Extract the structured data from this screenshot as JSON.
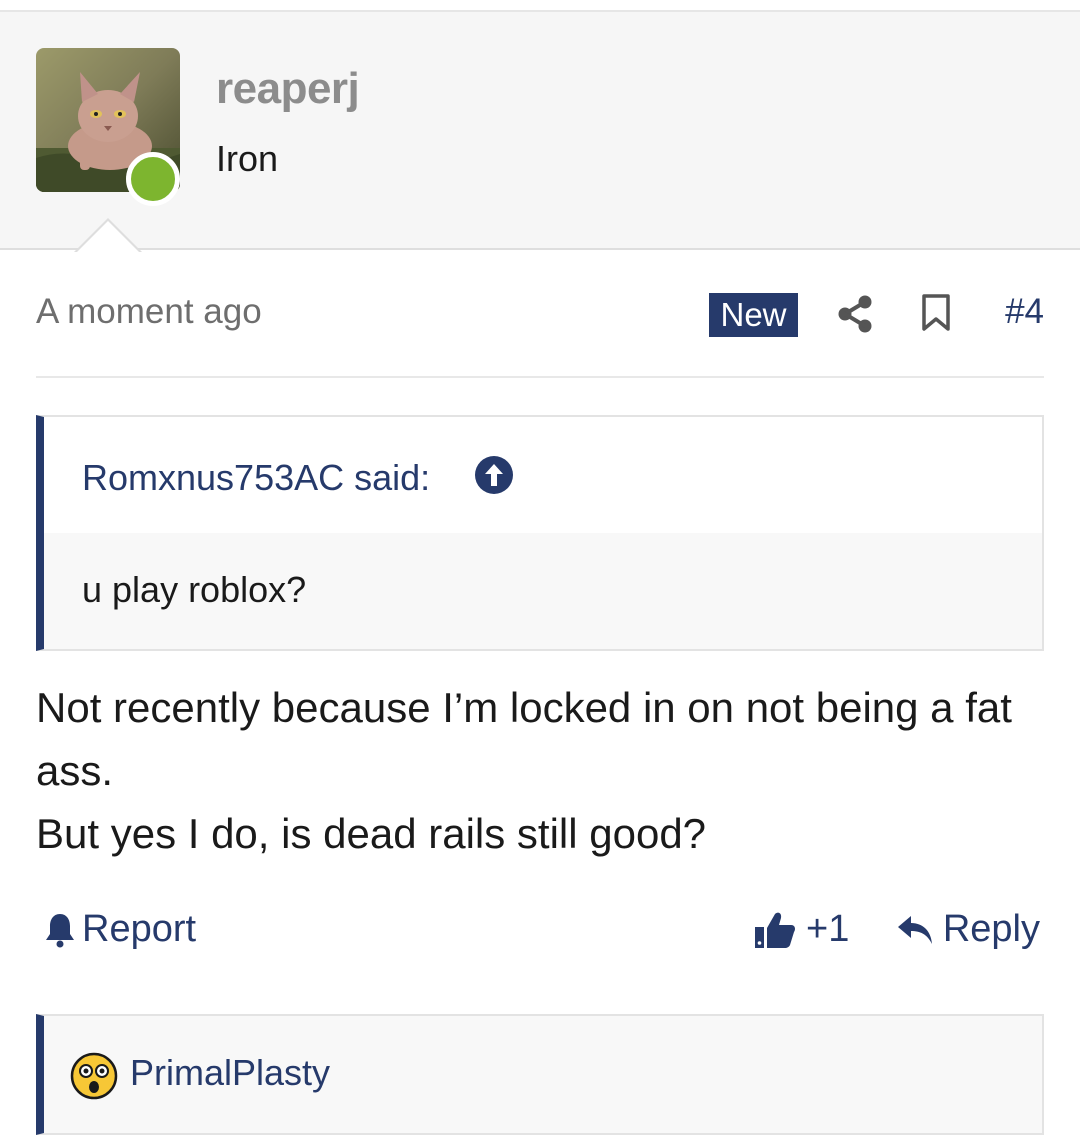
{
  "author": {
    "username": "reaperj",
    "title": "Iron",
    "avatar": "hairless-sphynx-cat-photo",
    "online": true
  },
  "post": {
    "time": "A moment ago",
    "new_badge": "New",
    "number": "#4"
  },
  "quote": {
    "author_line": "Romxnus753AC said:",
    "text": "u play roblox?"
  },
  "message": {
    "lines": [
      "Not recently because I’m locked in on not being a fat ass.",
      "But yes I do, is dead rails still good?"
    ]
  },
  "actions": {
    "report_label": "Report",
    "like_count": "+1",
    "reply_label": "Reply"
  },
  "reactions": {
    "emoji": "astonished-face",
    "users": "PrimalPlasty"
  },
  "colors": {
    "accent": "#263a6b",
    "online": "#7db52f",
    "header_bg": "#f6f6f6"
  }
}
